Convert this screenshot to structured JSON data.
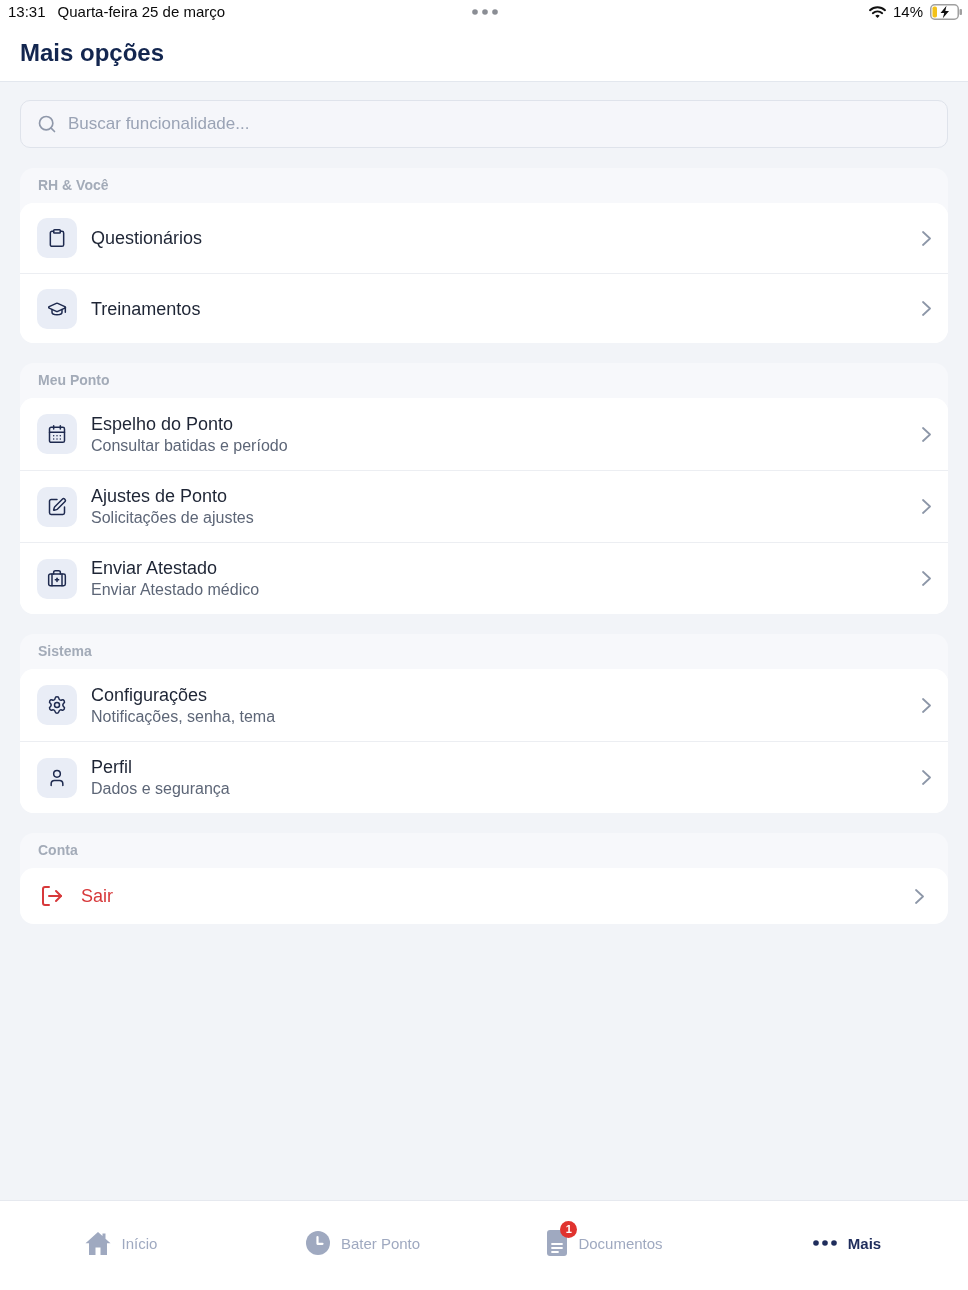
{
  "status_bar": {
    "time": "13:31",
    "date": "Quarta-feira 25 de março",
    "battery_percent": "14%"
  },
  "header": {
    "title": "Mais opções"
  },
  "search": {
    "placeholder": "Buscar funcionalidade..."
  },
  "sections": [
    {
      "title": "RH & Você",
      "items": [
        {
          "kind": "clipboard",
          "title": "Questionários"
        },
        {
          "kind": "graduation",
          "title": "Treinamentos"
        }
      ]
    },
    {
      "title": "Meu Ponto",
      "items": [
        {
          "kind": "calendar",
          "title": "Espelho do Ponto",
          "subtitle": "Consultar batidas e período"
        },
        {
          "kind": "edit",
          "title": "Ajustes de Ponto",
          "subtitle": "Solicitações de ajustes"
        },
        {
          "kind": "medical",
          "title": "Enviar Atestado",
          "subtitle": "Enviar Atestado médico"
        }
      ]
    },
    {
      "title": "Sistema",
      "items": [
        {
          "kind": "settings",
          "title": "Configurações",
          "subtitle": "Notificações, senha, tema"
        },
        {
          "kind": "user",
          "title": "Perfil",
          "subtitle": "Dados e segurança"
        }
      ]
    },
    {
      "title": "Conta",
      "items": [
        {
          "kind": "logout",
          "title": "Sair"
        }
      ]
    }
  ],
  "tab_bar": [
    {
      "kind": "home",
      "label": "Início",
      "selected": false
    },
    {
      "kind": "clock",
      "label": "Bater Ponto",
      "selected": false
    },
    {
      "kind": "document",
      "label": "Documentos",
      "badge": "1",
      "selected": false
    },
    {
      "kind": "more",
      "label": "Mais",
      "selected": true
    }
  ]
}
